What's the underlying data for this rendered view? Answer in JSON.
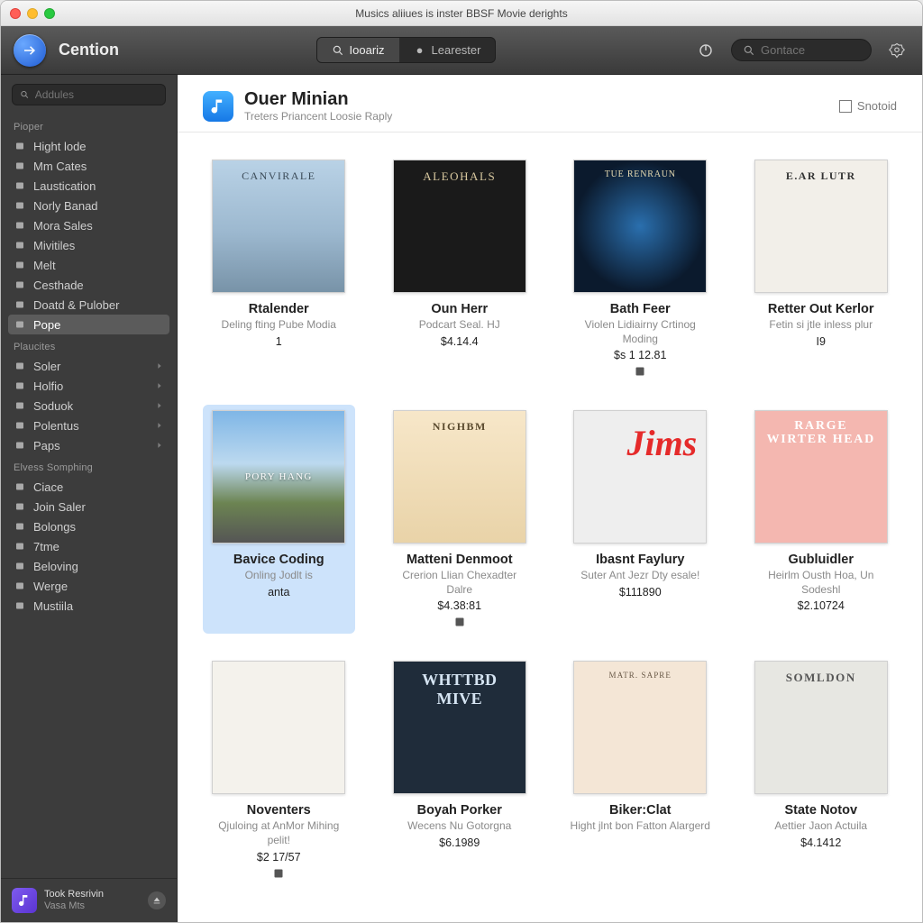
{
  "window": {
    "title": "Musics aliiues is inster BBSF Movie derights"
  },
  "toolbar": {
    "brand": "Cention",
    "seg": {
      "left": "Iooariz",
      "right": "Learester"
    },
    "search_placeholder": "Gontace"
  },
  "sidebar": {
    "search_placeholder": "Addules",
    "sections": [
      {
        "title": "Pioper",
        "items": [
          {
            "label": "Hight lode"
          },
          {
            "label": "Mm Cates"
          },
          {
            "label": "Laustication"
          },
          {
            "label": "Norly Banad"
          },
          {
            "label": "Mora Sales"
          },
          {
            "label": "Mivitiles"
          },
          {
            "label": "Melt"
          },
          {
            "label": "Cesthade"
          },
          {
            "label": "Doatd & Pulober"
          },
          {
            "label": "Pope",
            "selected": true
          }
        ]
      },
      {
        "title": "Plaucites",
        "items": [
          {
            "label": "Soler",
            "chev": true
          },
          {
            "label": "Holfio",
            "chev": true
          },
          {
            "label": "Soduok",
            "chev": true
          },
          {
            "label": "Polentus",
            "chev": true
          },
          {
            "label": "Paps",
            "chev": true
          }
        ]
      },
      {
        "title": "Elvess Somphing",
        "items": [
          {
            "label": "Ciace"
          },
          {
            "label": "Join Saler"
          },
          {
            "label": "Bolongs"
          },
          {
            "label": "7tme"
          },
          {
            "label": "Beloving"
          },
          {
            "label": "Werge"
          },
          {
            "label": "Mustiila"
          }
        ]
      }
    ],
    "footer": {
      "line1": "Took Resrivin",
      "line2": "Vasa Mts"
    }
  },
  "header": {
    "title": "Ouer Minian",
    "subtitle": "Treters Priancent Loosie Raply",
    "action": "Snotoid"
  },
  "albums": [
    {
      "title": "Rtalender",
      "subtitle": "Deling fting Pube Modia",
      "price": "1",
      "art": "CANVIRALE"
    },
    {
      "title": "Oun Herr",
      "subtitle": "Podcart Seal. HJ",
      "price": "$4.14.4",
      "art": "ALEOHALS"
    },
    {
      "title": "Bath Feer",
      "subtitle": "Violen Lidiairny Crtinog Moding",
      "price": "$s 1 12.81",
      "icon": true,
      "art": "TUE RENRAUN"
    },
    {
      "title": "Retter Out Kerlor",
      "subtitle": "Fetin si jtle inless plur",
      "price": "I9",
      "art": "E.AR LUTR"
    },
    {
      "title": "Bavice Coding",
      "subtitle": "Onling Jodlt is",
      "price": "anta",
      "selected": true,
      "art": "PORY HANG"
    },
    {
      "title": "Matteni Denmoot",
      "subtitle": "Crerion Llian Chexadter Dalre",
      "price": "$4.38:81",
      "icon": true,
      "art": "NIGHBM"
    },
    {
      "title": "Ibasnt Faylury",
      "subtitle": "Suter Ant Jezr Dty esale!",
      "price": "$111890",
      "art": "JIMS"
    },
    {
      "title": "Gubluidler",
      "subtitle": "Heirlm Ousth Hoa, Un Sodeshl",
      "price": "$2.10724",
      "art": "RARGE WIRTER HEAD"
    },
    {
      "title": "Noventers",
      "subtitle": "Qjuloing at AnMor Mihing pelit!",
      "price": "$2 17/57",
      "icon": true,
      "art": ""
    },
    {
      "title": "Boyah Porker",
      "subtitle": "Wecens Nu Gotorgna",
      "price": "$6.1989",
      "art": "WHTTBD MIVE"
    },
    {
      "title": "Biker:Clat",
      "subtitle": "Hight jlnt bon Fatton Alargerd",
      "price": "",
      "art": "MATR. SAPRE"
    },
    {
      "title": "State Notov",
      "subtitle": "Aettier Jaon Actuila",
      "price": "$4.1412",
      "art": "SOMLDON"
    }
  ]
}
